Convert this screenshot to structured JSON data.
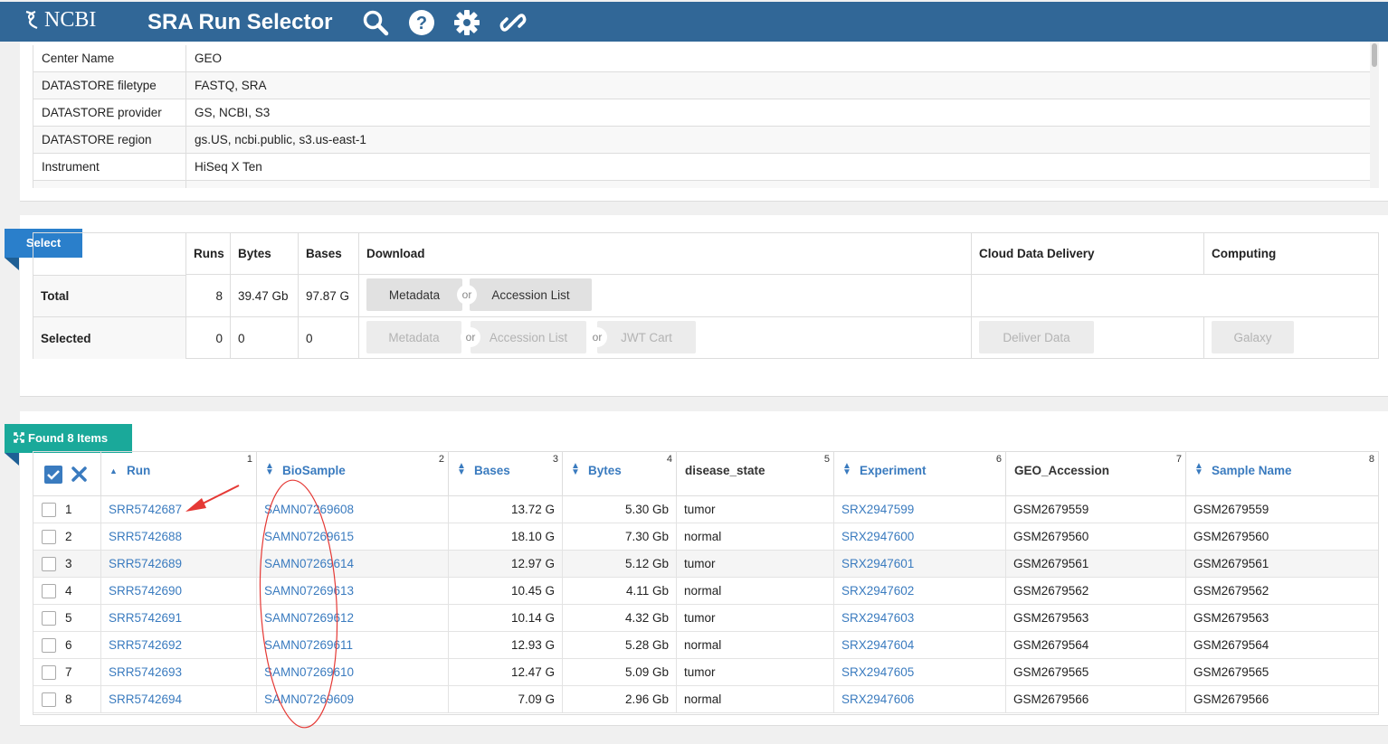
{
  "header": {
    "logo_text": "NCBI",
    "app_title": "SRA Run Selector",
    "icons": [
      "search-icon",
      "help-icon",
      "settings-icon",
      "link-icon"
    ],
    "color": "#316797"
  },
  "metadata": [
    {
      "key": "Center Name",
      "value": "GEO"
    },
    {
      "key": "DATASTORE filetype",
      "value": "FASTQ, SRA"
    },
    {
      "key": "DATASTORE provider",
      "value": "GS, NCBI, S3"
    },
    {
      "key": "DATASTORE region",
      "value": "gs.US, ncbi.public, s3.us-east-1"
    },
    {
      "key": "Instrument",
      "value": "HiSeq X Ten"
    }
  ],
  "select": {
    "tab_label": "Select",
    "headers": {
      "runs": "Runs",
      "bytes": "Bytes",
      "bases": "Bases",
      "download": "Download",
      "cloud": "Cloud Data Delivery",
      "computing": "Computing"
    },
    "total": {
      "label": "Total",
      "runs": "8",
      "bytes": "39.47 Gb",
      "bases": "97.87 G"
    },
    "selected": {
      "label": "Selected",
      "runs": "0",
      "bytes": "0",
      "bases": "0"
    },
    "buttons": {
      "metadata": "Metadata",
      "accession_list": "Accession List",
      "jwt_cart": "JWT Cart",
      "deliver": "Deliver Data",
      "galaxy": "Galaxy",
      "or": "or"
    }
  },
  "results": {
    "found_label": "Found 8 Items",
    "columns": [
      {
        "label": "Run",
        "num": "1"
      },
      {
        "label": "BioSample",
        "num": "2"
      },
      {
        "label": "Bases",
        "num": "3"
      },
      {
        "label": "Bytes",
        "num": "4"
      },
      {
        "label": "disease_state",
        "num": "5"
      },
      {
        "label": "Experiment",
        "num": "6"
      },
      {
        "label": "GEO_Accession",
        "num": "7"
      },
      {
        "label": "Sample Name",
        "num": "8"
      }
    ],
    "rows": [
      {
        "n": "1",
        "run": "SRR5742687",
        "biosample": "SAMN07269608",
        "bases": "13.72 G",
        "bytes": "5.30 Gb",
        "disease": "tumor",
        "experiment": "SRX2947599",
        "geo": "GSM2679559",
        "sample": "GSM2679559"
      },
      {
        "n": "2",
        "run": "SRR5742688",
        "biosample": "SAMN07269615",
        "bases": "18.10 G",
        "bytes": "7.30 Gb",
        "disease": "normal",
        "experiment": "SRX2947600",
        "geo": "GSM2679560",
        "sample": "GSM2679560"
      },
      {
        "n": "3",
        "run": "SRR5742689",
        "biosample": "SAMN07269614",
        "bases": "12.97 G",
        "bytes": "5.12 Gb",
        "disease": "tumor",
        "experiment": "SRX2947601",
        "geo": "GSM2679561",
        "sample": "GSM2679561"
      },
      {
        "n": "4",
        "run": "SRR5742690",
        "biosample": "SAMN07269613",
        "bases": "10.45 G",
        "bytes": "4.11 Gb",
        "disease": "normal",
        "experiment": "SRX2947602",
        "geo": "GSM2679562",
        "sample": "GSM2679562"
      },
      {
        "n": "5",
        "run": "SRR5742691",
        "biosample": "SAMN07269612",
        "bases": "10.14 G",
        "bytes": "4.32 Gb",
        "disease": "tumor",
        "experiment": "SRX2947603",
        "geo": "GSM2679563",
        "sample": "GSM2679563"
      },
      {
        "n": "6",
        "run": "SRR5742692",
        "biosample": "SAMN07269611",
        "bases": "12.93 G",
        "bytes": "5.28 Gb",
        "disease": "normal",
        "experiment": "SRX2947604",
        "geo": "GSM2679564",
        "sample": "GSM2679564"
      },
      {
        "n": "7",
        "run": "SRR5742693",
        "biosample": "SAMN07269610",
        "bases": "12.47 G",
        "bytes": "5.09 Gb",
        "disease": "tumor",
        "experiment": "SRX2947605",
        "geo": "GSM2679565",
        "sample": "GSM2679565"
      },
      {
        "n": "8",
        "run": "SRR5742694",
        "biosample": "SAMN07269609",
        "bases": "7.09 G",
        "bytes": "2.96 Gb",
        "disease": "normal",
        "experiment": "SRX2947606",
        "geo": "GSM2679566",
        "sample": "GSM2679566"
      }
    ]
  },
  "colors": {
    "link": "#3a7bbf",
    "select_tab": "#2a7fcb",
    "found_tab": "#1aa99a",
    "annotation": "#e53935"
  }
}
